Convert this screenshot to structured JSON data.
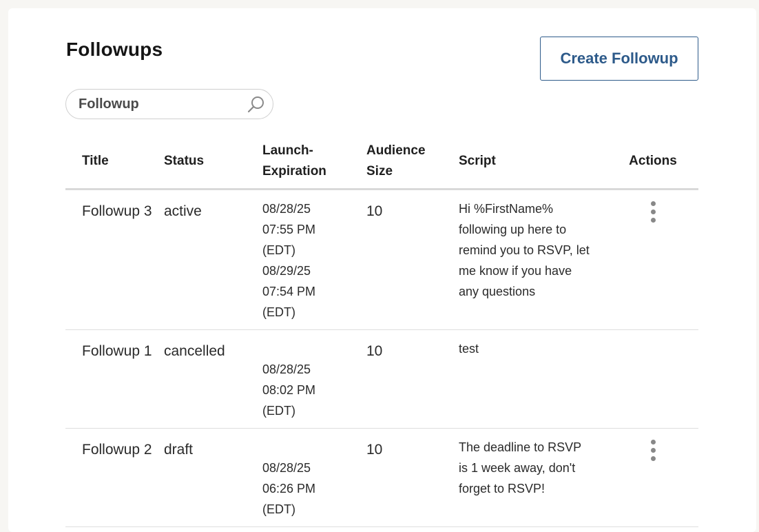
{
  "page": {
    "title": "Followups",
    "create_button_label": "Create Followup"
  },
  "search": {
    "value": "Followup",
    "icon": "search-icon"
  },
  "table": {
    "headers": {
      "title": "Title",
      "status": "Status",
      "launch_line1": "Launch-",
      "launch_line2": "Expiration",
      "audience_line1": "Audience",
      "audience_line2": "Size",
      "script": "Script",
      "actions": "Actions"
    },
    "rows": [
      {
        "title": "Followup 3",
        "status": "active",
        "launch_date": "08/28/25",
        "launch_time": "07:55 PM",
        "launch_tz": "(EDT)",
        "expiration_date": "08/29/25",
        "expiration_time": "07:54 PM",
        "expiration_tz": "(EDT)",
        "audience_size": "10",
        "script": "Hi %FirstName% following up here to remind you to RSVP, let me know if you have any questions",
        "has_actions": true
      },
      {
        "title": "Followup 1",
        "status": "cancelled",
        "launch_date": "",
        "launch_time": "",
        "launch_tz": "",
        "expiration_date": "08/28/25",
        "expiration_time": "08:02 PM",
        "expiration_tz": "(EDT)",
        "audience_size": "10",
        "script": "test",
        "has_actions": false
      },
      {
        "title": "Followup 2",
        "status": "draft",
        "launch_date": "",
        "launch_time": "",
        "launch_tz": "",
        "expiration_date": "08/28/25",
        "expiration_time": "06:26 PM",
        "expiration_tz": "(EDT)",
        "audience_size": "10",
        "script": "The deadline to RSVP is 1 week away, don't forget to RSVP!",
        "has_actions": true
      }
    ]
  },
  "colors": {
    "accent": "#2d5a8a",
    "background": "#f7f6f3",
    "card": "#ffffff",
    "divider": "#d9d9d9",
    "kebab": "#888888"
  }
}
